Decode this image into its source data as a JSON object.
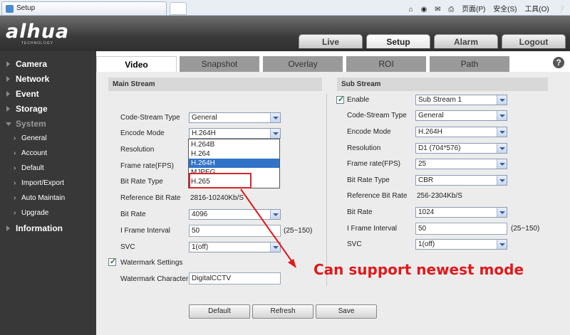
{
  "browser": {
    "tab_title": "Setup",
    "toolbar": [
      "页面(P)",
      "安全(S)",
      "工具(O)"
    ]
  },
  "brand": {
    "logo": "alhua",
    "tagline": "TECHNOLOGY"
  },
  "nav": {
    "live": "Live",
    "setup": "Setup",
    "alarm": "Alarm",
    "logout": "Logout"
  },
  "sidebar": {
    "camera": "Camera",
    "network": "Network",
    "event": "Event",
    "storage": "Storage",
    "system": "System",
    "system_items": [
      "General",
      "Account",
      "Default",
      "Import/Export",
      "Auto Maintain",
      "Upgrade"
    ],
    "information": "Information"
  },
  "tabs": [
    "Video",
    "Snapshot",
    "Overlay",
    "ROI",
    "Path"
  ],
  "help_icon": "?",
  "main": {
    "title": "Main Stream",
    "code_stream_type": {
      "label": "Code-Stream Type",
      "value": "General"
    },
    "encode_mode": {
      "label": "Encode Mode",
      "value": "H.264H"
    },
    "encode_options": [
      "H.264B",
      "H.264",
      "H.264H",
      "MJPEG",
      "H.265"
    ],
    "encode_options_highlight": "H.264H",
    "resolution": {
      "label": "Resolution"
    },
    "frame_rate": {
      "label": "Frame rate(FPS)"
    },
    "bit_rate_type": {
      "label": "Bit Rate Type"
    },
    "reference_bit_rate": {
      "label": "Reference Bit Rate",
      "value": "2816-10240Kb/S"
    },
    "bit_rate": {
      "label": "Bit Rate",
      "value": "4096"
    },
    "i_frame": {
      "label": "I Frame Interval",
      "value": "50",
      "range": "(25~150)"
    },
    "svc": {
      "label": "SVC",
      "value": "1(off)"
    },
    "watermark_settings": "Watermark Settings",
    "watermark_character": {
      "label": "Watermark Character",
      "value": "DigitalCCTV"
    }
  },
  "sub": {
    "title": "Sub Stream",
    "enable": {
      "label": "Enable",
      "value": "Sub Stream 1"
    },
    "code_stream_type": {
      "label": "Code-Stream Type",
      "value": "General"
    },
    "encode_mode": {
      "label": "Encode Mode",
      "value": "H.264H"
    },
    "resolution": {
      "label": "Resolution",
      "value": "D1 (704*576)"
    },
    "frame_rate": {
      "label": "Frame rate(FPS)",
      "value": "25"
    },
    "bit_rate_type": {
      "label": "Bit Rate Type",
      "value": "CBR"
    },
    "reference_bit_rate": {
      "label": "Reference Bit Rate",
      "value": "256-2304Kb/S"
    },
    "bit_rate": {
      "label": "Bit Rate",
      "value": "1024"
    },
    "i_frame": {
      "label": "I Frame Interval",
      "value": "50",
      "range": "(25~150)"
    },
    "svc": {
      "label": "SVC",
      "value": "1(off)"
    }
  },
  "buttons": {
    "default": "Default",
    "refresh": "Refresh",
    "save": "Save"
  },
  "annotation": "Can support newest mode",
  "colors": {
    "annotation": "#e0191b",
    "highlight": "#3173c6",
    "header": "#3a3a3a"
  }
}
